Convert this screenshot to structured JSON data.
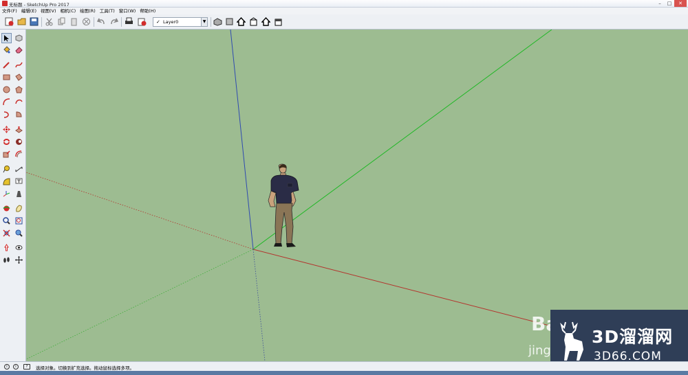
{
  "window": {
    "title": "无标题 - SketchUp Pro 2017",
    "controls": {
      "minimize": "–",
      "maximize": "□",
      "close": "✕"
    }
  },
  "menu": [
    "文件(F)",
    "编辑(E)",
    "视图(V)",
    "相机(C)",
    "绘图(R)",
    "工具(T)",
    "窗口(W)",
    "帮助(H)"
  ],
  "toolbar": {
    "layer": {
      "check": "✓",
      "name": "Layer0",
      "arrow": "▼"
    }
  },
  "status": {
    "text": "选择对象。切换到扩充选择。拖动鼠标选择多项。",
    "icons": [
      "info-icon",
      "geo-icon"
    ]
  },
  "watermark": {
    "brand": "3D溜溜网",
    "url": "3D66.COM",
    "baidu": "Bai",
    "baidu_sub": "jing"
  },
  "colors": {
    "viewport_bg": "#9dbc91",
    "axis_red": "#b4322c",
    "axis_green": "#20b826",
    "axis_blue": "#2f4ab0",
    "accent": "#d22c2c"
  }
}
